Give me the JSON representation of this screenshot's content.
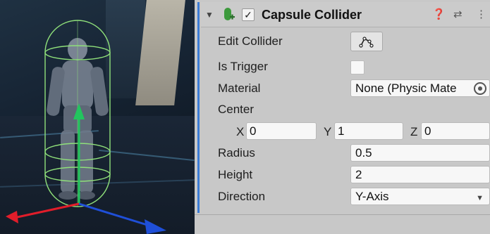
{
  "component": {
    "title": "Capsule Collider",
    "foldout_glyph": "▼",
    "enabled_glyph": "✓",
    "help_glyph": "❓",
    "presets_glyph": "⇄",
    "menu_glyph": "⋮"
  },
  "fields": {
    "edit_collider_label": "Edit Collider",
    "is_trigger_label": "Is Trigger",
    "is_trigger_checked": false,
    "material_label": "Material",
    "material_value": "None (Physic Mate",
    "center_label": "Center",
    "center_x_label": "X",
    "center_x": "0",
    "center_y_label": "Y",
    "center_y": "1",
    "center_z_label": "Z",
    "center_z": "0",
    "radius_label": "Radius",
    "radius_value": "0.5",
    "height_label": "Height",
    "height_value": "2",
    "direction_label": "Direction",
    "direction_value": "Y-Axis",
    "dropdown_glyph": "▼"
  },
  "colors": {
    "accent": "#3a7bd5",
    "inspector_bg": "#c8c8c8",
    "gizmo_green": "#8fe07a",
    "axis_green": "#22c55e",
    "axis_red": "#e11d2a",
    "axis_blue": "#1f4fd8"
  },
  "icons": {
    "component": "capsule-collider-icon",
    "edit_collider": "edit-collider-icon",
    "help": "help-icon",
    "presets": "presets-icon",
    "menu": "menu-kebab-icon",
    "object_picker": "object-picker-icon"
  }
}
